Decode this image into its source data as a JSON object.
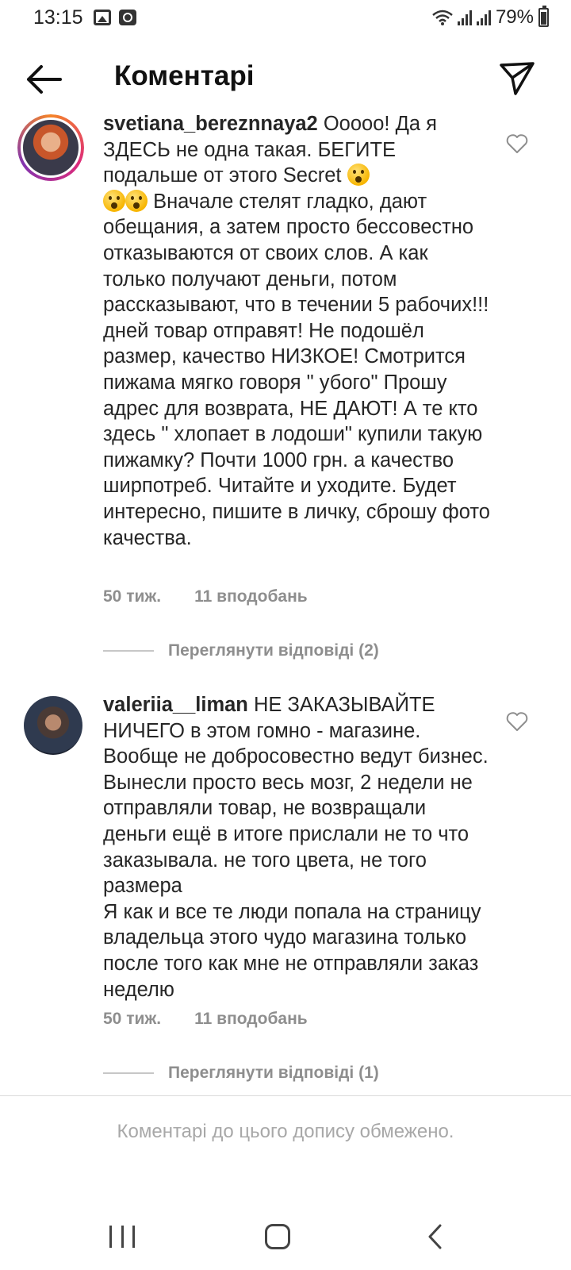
{
  "status_bar": {
    "time": "13:15",
    "battery_percent": "79%",
    "icons": [
      "image-icon",
      "clock-app-icon",
      "wifi-icon",
      "signal-icon",
      "signal-icon",
      "battery-icon"
    ]
  },
  "header": {
    "title": "Коментарі",
    "back_icon": "arrow-left-icon",
    "share_icon": "send-icon"
  },
  "comments": [
    {
      "username": "svetiana_bereznnaya2",
      "text_1": "Ооооо! Да я ЗДЕСЬ не одна такая. БЕГИТЕ подальше от этого Secret",
      "text_2": "Вначале стелят гладко, дают обещания, а затем просто бессовестно отказываются от своих слов. А как только получают деньги, потом рассказывают, что в течении 5 рабочих!!! дней товар отправят! Не подошёл размер, качество НИЗКОЕ! Смотрится пижама мягко говоря \" убого\"  Прошу адрес для возврата, НЕ ДАЮТ!  А те кто здесь \" хлопает в лодоши\"  купили такую пижамку? Почти 1000 грн. а качество ширпотреб. Читайте и уходите. Будет интересно, пишите в личку, сброшу фото качества.",
      "time": "50 тиж.",
      "likes": "11 вподобань",
      "view_replies": "Переглянути відповіді (2)"
    },
    {
      "username": "valeriia__liman",
      "text": "НЕ ЗАКАЗЫВАЙТЕ НИЧЕГО в этом гомно - магазине. Вообще не добросовестно ведут бизнес. Вынесли просто весь мозг, 2 недели не отправляли товар, не возвращали деньги ещё в итоге прислали не то что заказывала. не того цвета, не того размера",
      "text_2": "Я как и все те люди попала на страницу владельца этого чудо магазина только после того как мне не отправляли заказ неделю",
      "time": "50 тиж.",
      "likes": "11 вподобань",
      "view_replies": "Переглянути відповіді (1)"
    }
  ],
  "footer": {
    "restricted_text": "Коментарі до цього допису обмежено."
  },
  "colors": {
    "text": "#262626",
    "muted": "#8e8e8e",
    "footer_text": "#a8a8a8"
  }
}
